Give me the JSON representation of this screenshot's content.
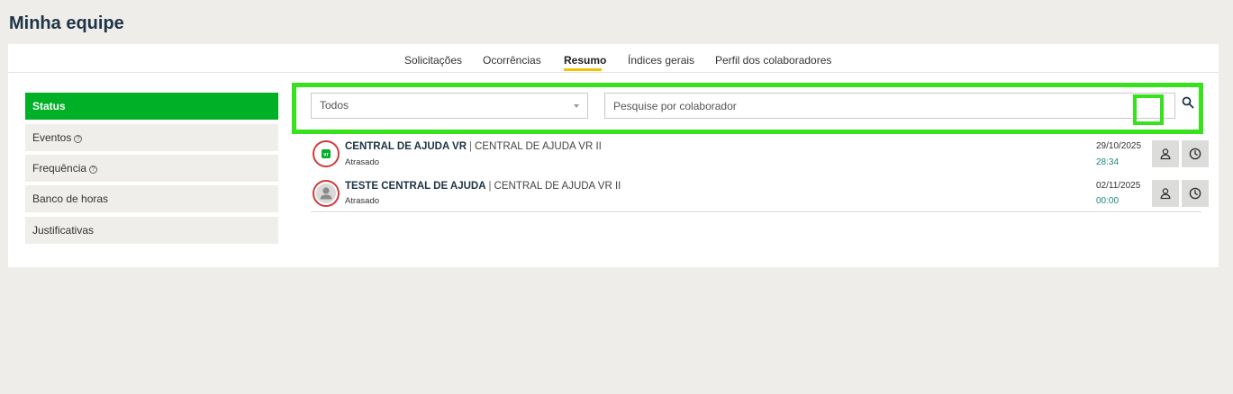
{
  "page": {
    "title": "Minha equipe"
  },
  "tabs": [
    {
      "label": "Solicitações",
      "active": false
    },
    {
      "label": "Ocorrências",
      "active": false
    },
    {
      "label": "Resumo",
      "active": true
    },
    {
      "label": "Índices gerais",
      "active": false
    },
    {
      "label": "Perfil dos colaboradores",
      "active": false
    }
  ],
  "sidebar": {
    "items": [
      {
        "label": "Status",
        "active": true,
        "help": false
      },
      {
        "label": "Eventos",
        "active": false,
        "help": true
      },
      {
        "label": "Frequência",
        "active": false,
        "help": true
      },
      {
        "label": "Banco de horas",
        "active": false,
        "help": false
      },
      {
        "label": "Justificativas",
        "active": false,
        "help": false
      }
    ]
  },
  "filter": {
    "selected": "Todos"
  },
  "search": {
    "placeholder": "Pesquise por colaborador",
    "value": ""
  },
  "rows": [
    {
      "name": "CENTRAL DE AJUDA VR",
      "separator": "|",
      "company": "CENTRAL DE AJUDA VR II",
      "status": "Atrasado",
      "date": "29/10/2025",
      "time": "28:34",
      "avatar": "vr-logo-icon"
    },
    {
      "name": "TESTE CENTRAL DE AJUDA",
      "separator": "|",
      "company": "CENTRAL DE AJUDA VR II",
      "status": "Atrasado",
      "date": "02/11/2025",
      "time": "00:00",
      "avatar": "user-silhouette-icon"
    }
  ],
  "colors": {
    "accent_green": "#00b026",
    "highlight": "#37e21d",
    "title": "#1d3346",
    "tab_active_underline": "#f2c200",
    "avatar_ring": "#d23b3b",
    "time_text": "#1a8a7a"
  }
}
